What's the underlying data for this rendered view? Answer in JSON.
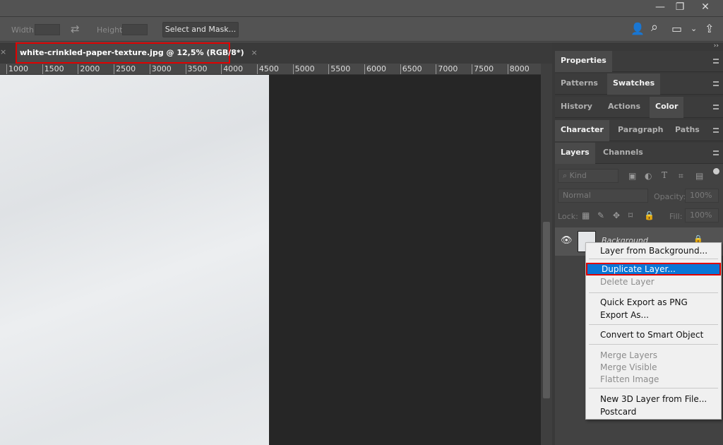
{
  "window": {
    "minimize": "—",
    "restore": "❐",
    "close": "✕"
  },
  "options": {
    "width_label": "Width:",
    "height_label": "Height:",
    "swap_icon": "⇄",
    "select_and_mask": "Select and Mask..."
  },
  "toolbar_icons": {
    "account": "👤",
    "search": "⌕",
    "workspace": "▭",
    "dropdown": "⌄",
    "share": "⇪"
  },
  "document": {
    "tab_title": "white-crinkled-paper-texture.jpg @ 12,5% (RGB/8*)",
    "close": "×",
    "prev_close": "×"
  },
  "ruler": {
    "ticks": [
      "1000",
      "1500",
      "2000",
      "2500",
      "3000",
      "3500",
      "4000",
      "4500",
      "5000",
      "5500",
      "6000",
      "6500",
      "7000",
      "7500",
      "8000"
    ]
  },
  "panels": {
    "collapse": "››",
    "groups": [
      {
        "tabs": [
          "Properties"
        ],
        "active": 0
      },
      {
        "tabs": [
          "Patterns",
          "Swatches"
        ],
        "active": 1
      },
      {
        "tabs": [
          "History",
          "Actions",
          "Color"
        ],
        "active": 2
      },
      {
        "tabs": [
          "Character",
          "Paragraph",
          "Paths"
        ],
        "active": 0
      },
      {
        "tabs": [
          "Layers",
          "Channels"
        ],
        "active": 0
      }
    ]
  },
  "layers": {
    "kind_placeholder": "Kind",
    "blend_mode": "Normal",
    "opacity_label": "Opacity:",
    "opacity": "100%",
    "lock_label": "Lock:",
    "fill_label": "Fill:",
    "fill": "100%",
    "layer_name": "Background"
  },
  "context_menu": {
    "items": [
      {
        "label": "Layer from Background...",
        "state": "normal"
      },
      {
        "label": "Duplicate Layer...",
        "state": "highlighted"
      },
      {
        "label": "Delete Layer",
        "state": "disabled"
      },
      {
        "label": "Quick Export as PNG",
        "state": "normal"
      },
      {
        "label": "Export As...",
        "state": "normal"
      },
      {
        "label": "Convert to Smart Object",
        "state": "normal"
      },
      {
        "label": "Merge Layers",
        "state": "disabled"
      },
      {
        "label": "Merge Visible",
        "state": "disabled"
      },
      {
        "label": "Flatten Image",
        "state": "disabled"
      },
      {
        "label": "New 3D Layer from File...",
        "state": "normal"
      },
      {
        "label": "Postcard",
        "state": "normal"
      }
    ]
  }
}
